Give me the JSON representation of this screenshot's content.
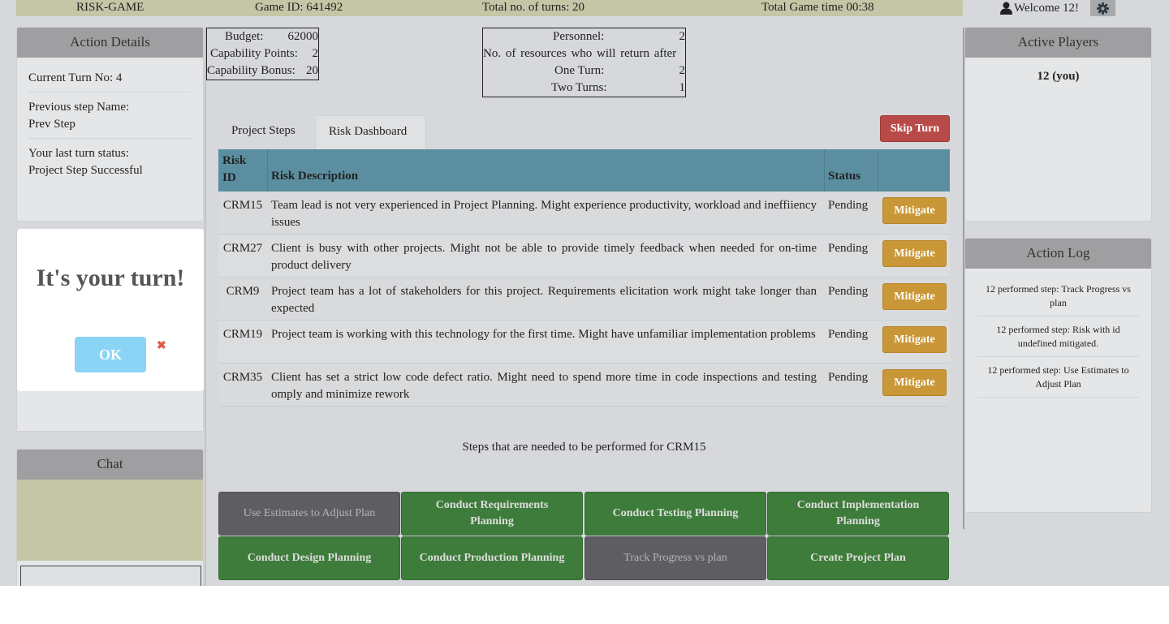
{
  "topbar": {
    "app_name": "RISK-GAME",
    "game_id": "Game ID: 641492",
    "total_turns": "Total no. of turns: 20",
    "total_time": "Total Game time 00:38",
    "welcome": "Welcome 12!"
  },
  "action_details": {
    "title": "Action Details",
    "current_turn": "Current Turn No: 4",
    "prev_step_label": "Previous step Name:",
    "prev_step_value": "Prev Step",
    "last_status_label": "Your last turn status:",
    "last_status_value": "Project Step Successful"
  },
  "budget_box": {
    "rows": [
      {
        "label": "Budget:",
        "value": "62000"
      },
      {
        "label": "Capability Points:",
        "value": "2"
      },
      {
        "label": "Capability Bonus:",
        "value": "20"
      }
    ]
  },
  "personnel_box": {
    "personnel_label": "Personnel:",
    "personnel_value": "2",
    "resources_label": "No. of resources who will return after",
    "one_turn_label": "One Turn:",
    "one_turn_value": "2",
    "two_turns_label": "Two Turns:",
    "two_turns_value": "1"
  },
  "tabs": [
    "Project Steps",
    "Risk Dashboard"
  ],
  "skip_turn": "Skip Turn",
  "risk_table": {
    "headers": {
      "id_line1": "Risk",
      "id_line2": "ID",
      "description": "Risk Description",
      "status": "Status"
    },
    "rows": [
      {
        "id": "CRM15",
        "description": "Team lead is not very experienced in Project Planning. Might experience productivity, workload and ineffiiency issues",
        "status": "Pending",
        "action": "Mitigate"
      },
      {
        "id": "CRM27",
        "description": "Client is busy with other projects. Might not be able to provide timely feedback when needed for on-time product delivery",
        "status": "Pending",
        "action": "Mitigate"
      },
      {
        "id": "CRM9",
        "description": "Project team has a lot of stakeholders for this project. Requirements elicitation work might take longer than expected",
        "status": "Pending",
        "action": "Mitigate"
      },
      {
        "id": "CRM19",
        "description": "Project team is working with this technology for the first time. Might have unfamiliar implementation problems",
        "status": "Pending",
        "action": "Mitigate"
      },
      {
        "id": "CRM35",
        "description": "Client has set a strict low code defect ratio. Might need to spend more time in code inspections and testing omply and minimize rework",
        "status": "Pending",
        "action": "Mitigate"
      }
    ]
  },
  "steps_title": "Steps that are needed to be performed for CRM15",
  "steps": [
    {
      "label": "Use Estimates to Adjust Plan",
      "state": "disabled"
    },
    {
      "label": "Conduct Requirements Planning",
      "state": "enabled"
    },
    {
      "label": "Conduct Testing Planning",
      "state": "enabled"
    },
    {
      "label": "Conduct Implementation Planning",
      "state": "enabled"
    },
    {
      "label": "Conduct Design Planning",
      "state": "enabled"
    },
    {
      "label": "Conduct Production Planning",
      "state": "enabled"
    },
    {
      "label": "Track Progress vs plan",
      "state": "disabled"
    },
    {
      "label": "Create Project Plan",
      "state": "enabled"
    }
  ],
  "active_players": {
    "title": "Active Players",
    "players": [
      "12 (you)"
    ]
  },
  "action_log": {
    "title": "Action Log",
    "items": [
      "12 performed step: Track Progress vs plan",
      "12 performed step: Risk with id undefined mitigated.",
      "12 performed step: Use Estimates to Adjust Plan"
    ]
  },
  "chat": {
    "title": "Chat"
  },
  "modal": {
    "title": "It's your turn!",
    "ok": "OK",
    "close": "✖"
  },
  "colors": {
    "header_blue": "#5b8ea0",
    "mitigate_orange": "#c99737",
    "skip_red": "#b84a47",
    "step_green": "#3d7c3a",
    "step_gray": "#5e5e62",
    "ok_blue": "#8cd4f5"
  },
  "icons": {
    "user": "user-icon",
    "settings": "gear-icon",
    "close": "close-icon"
  }
}
